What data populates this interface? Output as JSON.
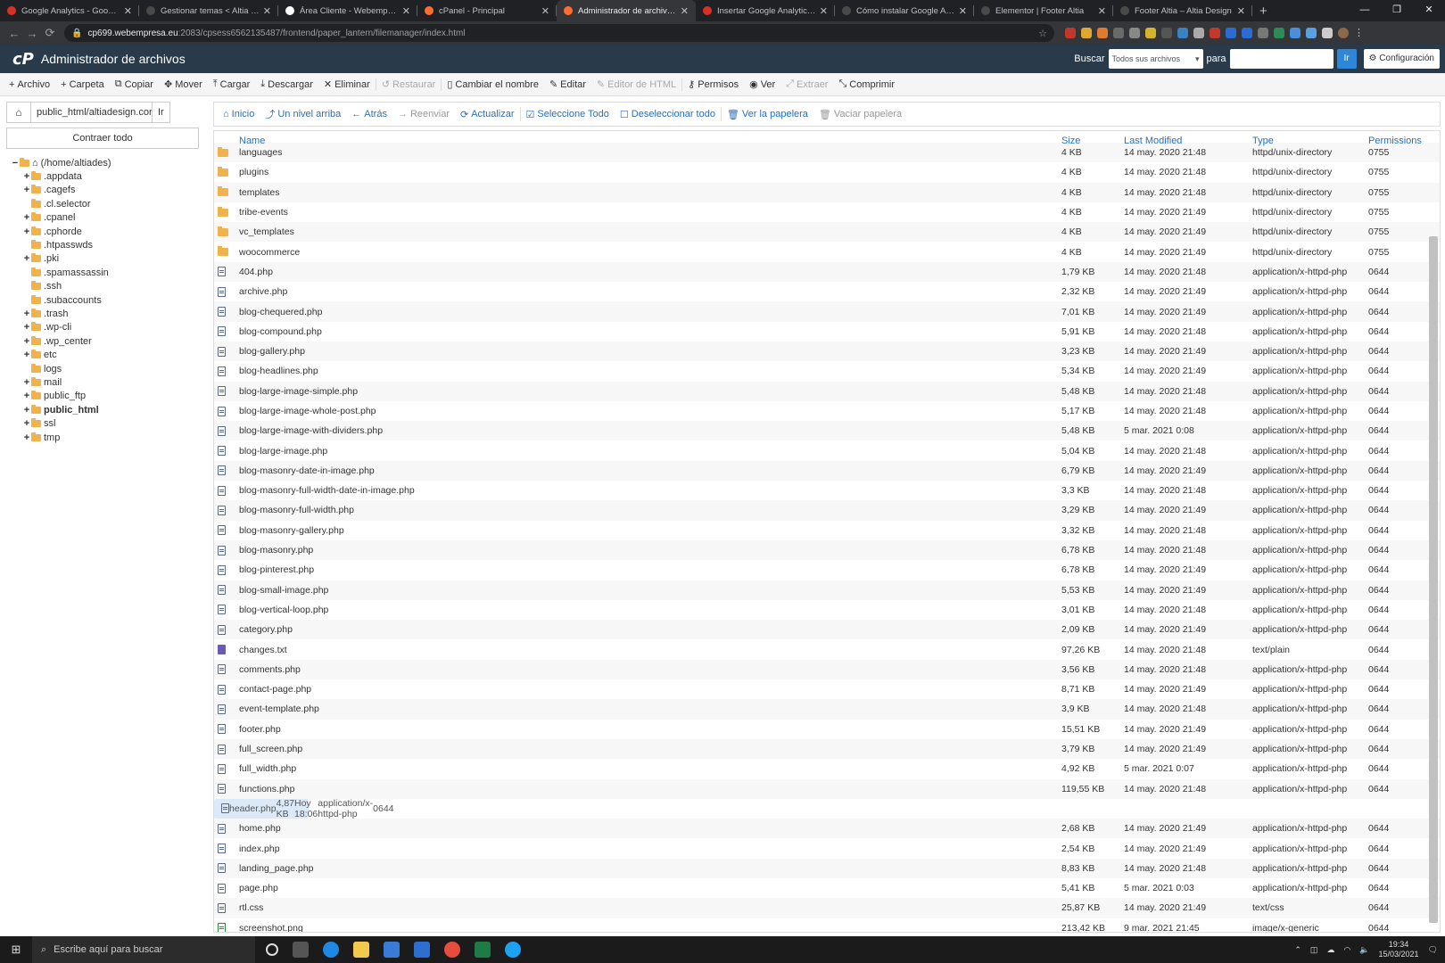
{
  "browser": {
    "tabs": [
      {
        "title": "Google Analytics - Google Tag",
        "color": "#d93025",
        "active": false
      },
      {
        "title": "Gestionar temas < Altia Design",
        "color": "#4a4a4a",
        "active": false
      },
      {
        "title": "Área Cliente - Webempresa E...",
        "color": "#ffffff",
        "active": false
      },
      {
        "title": "cPanel - Principal",
        "color": "#ff6c2c",
        "active": false
      },
      {
        "title": "Administrador de archivos cP...",
        "color": "#ff6c2c",
        "active": true
      },
      {
        "title": "Insertar Google Analytics con",
        "color": "#d93025",
        "active": false
      },
      {
        "title": "Cómo instalar Google Analytic",
        "color": "#4a4a4a",
        "active": false
      },
      {
        "title": "Elementor | Footer Altia",
        "color": "#4a4a4a",
        "active": false
      },
      {
        "title": "Footer Altia – Altia Design",
        "color": "#4a4a4a",
        "active": false
      }
    ],
    "url_host": "cp699.webempresa.eu",
    "url_rest": ":2083/cpsess6562135487/frontend/paper_lantern/filemanager/index.html"
  },
  "header": {
    "logo": "cP",
    "title": "Administrador de archivos",
    "search_label": "Buscar",
    "search_select": "Todos sus archivos",
    "for_label": "para",
    "go": "Ir",
    "settings": "Configuración"
  },
  "toolbar": {
    "items": [
      {
        "icon": "+",
        "label": "Archivo",
        "disabled": false
      },
      {
        "icon": "+",
        "label": "Carpeta",
        "disabled": false
      },
      {
        "icon": "⧉",
        "label": "Copiar",
        "disabled": false
      },
      {
        "icon": "✥",
        "label": "Mover",
        "disabled": false
      },
      {
        "icon": "⤒",
        "label": "Cargar",
        "disabled": false
      },
      {
        "icon": "⤓",
        "label": "Descargar",
        "disabled": false
      },
      {
        "icon": "✕",
        "label": "Eliminar",
        "disabled": false
      },
      {
        "icon": "↺",
        "label": "Restaurar",
        "disabled": true
      },
      {
        "icon": "▯",
        "label": "Cambiar el nombre",
        "disabled": false
      },
      {
        "icon": "✎",
        "label": "Editar",
        "disabled": false
      },
      {
        "icon": "✎",
        "label": "Editor de HTML",
        "disabled": true
      },
      {
        "icon": "⚷",
        "label": "Permisos",
        "disabled": false
      },
      {
        "icon": "◉",
        "label": "Ver",
        "disabled": false
      },
      {
        "icon": "⤢",
        "label": "Extraer",
        "disabled": true
      },
      {
        "icon": "⤡",
        "label": "Comprimir",
        "disabled": false
      }
    ]
  },
  "sidebar": {
    "path": "public_html/altiadesign.com/wp",
    "go": "Ir",
    "collapse_all": "Contraer todo",
    "tree": [
      {
        "label": "(/home/altiades)",
        "pm": "−",
        "indent": 0,
        "bold": false,
        "home": true
      },
      {
        "label": ".appdata",
        "pm": "+",
        "indent": 1,
        "bold": false
      },
      {
        "label": ".cagefs",
        "pm": "+",
        "indent": 1,
        "bold": false
      },
      {
        "label": ".cl.selector",
        "pm": "",
        "indent": 1,
        "bold": false
      },
      {
        "label": ".cpanel",
        "pm": "+",
        "indent": 1,
        "bold": false
      },
      {
        "label": ".cphorde",
        "pm": "+",
        "indent": 1,
        "bold": false
      },
      {
        "label": ".htpasswds",
        "pm": "",
        "indent": 1,
        "bold": false
      },
      {
        "label": ".pki",
        "pm": "+",
        "indent": 1,
        "bold": false
      },
      {
        "label": ".spamassassin",
        "pm": "",
        "indent": 1,
        "bold": false
      },
      {
        "label": ".ssh",
        "pm": "",
        "indent": 1,
        "bold": false
      },
      {
        "label": ".subaccounts",
        "pm": "",
        "indent": 1,
        "bold": false
      },
      {
        "label": ".trash",
        "pm": "+",
        "indent": 1,
        "bold": false
      },
      {
        "label": ".wp-cli",
        "pm": "+",
        "indent": 1,
        "bold": false
      },
      {
        "label": ".wp_center",
        "pm": "+",
        "indent": 1,
        "bold": false
      },
      {
        "label": "etc",
        "pm": "+",
        "indent": 1,
        "bold": false
      },
      {
        "label": "logs",
        "pm": "",
        "indent": 1,
        "bold": false
      },
      {
        "label": "mail",
        "pm": "+",
        "indent": 1,
        "bold": false
      },
      {
        "label": "public_ftp",
        "pm": "+",
        "indent": 1,
        "bold": false
      },
      {
        "label": "public_html",
        "pm": "+",
        "indent": 1,
        "bold": true
      },
      {
        "label": "ssl",
        "pm": "+",
        "indent": 1,
        "bold": false
      },
      {
        "label": "tmp",
        "pm": "+",
        "indent": 1,
        "bold": false
      }
    ]
  },
  "actions": {
    "items": [
      {
        "icon": "⌂",
        "label": "Inicio",
        "disabled": false
      },
      {
        "icon": "⤴",
        "label": "Un nivel arriba",
        "disabled": false
      },
      {
        "icon": "←",
        "label": "Atrás",
        "disabled": false
      },
      {
        "icon": "→",
        "label": "Reenviar",
        "disabled": true
      },
      {
        "icon": "⟳",
        "label": "Actualizar",
        "disabled": false
      },
      {
        "icon": "☑",
        "label": "Seleccione Todo",
        "disabled": false
      },
      {
        "icon": "☐",
        "label": "Deseleccionar todo",
        "disabled": false
      },
      {
        "icon": "🗑",
        "label": "Ver la papelera",
        "disabled": false
      },
      {
        "icon": "🗑",
        "label": "Vaciar papelera",
        "disabled": true
      }
    ]
  },
  "table": {
    "columns": [
      "Name",
      "Size",
      "Last Modified",
      "Type",
      "Permissions"
    ],
    "rows": [
      {
        "kind": "dir",
        "name": "languages",
        "size": "4 KB",
        "modified": "14 may. 2020 21:48",
        "type": "httpd/unix-directory",
        "perm": "0755"
      },
      {
        "kind": "dir",
        "name": "plugins",
        "size": "4 KB",
        "modified": "14 may. 2020 21:48",
        "type": "httpd/unix-directory",
        "perm": "0755"
      },
      {
        "kind": "dir",
        "name": "templates",
        "size": "4 KB",
        "modified": "14 may. 2020 21:48",
        "type": "httpd/unix-directory",
        "perm": "0755"
      },
      {
        "kind": "dir",
        "name": "tribe-events",
        "size": "4 KB",
        "modified": "14 may. 2020 21:49",
        "type": "httpd/unix-directory",
        "perm": "0755"
      },
      {
        "kind": "dir",
        "name": "vc_templates",
        "size": "4 KB",
        "modified": "14 may. 2020 21:49",
        "type": "httpd/unix-directory",
        "perm": "0755"
      },
      {
        "kind": "dir",
        "name": "woocommerce",
        "size": "4 KB",
        "modified": "14 may. 2020 21:49",
        "type": "httpd/unix-directory",
        "perm": "0755"
      },
      {
        "kind": "php",
        "name": "404.php",
        "size": "1,79 KB",
        "modified": "14 may. 2020 21:48",
        "type": "application/x-httpd-php",
        "perm": "0644"
      },
      {
        "kind": "php",
        "name": "archive.php",
        "size": "2,32 KB",
        "modified": "14 may. 2020 21:49",
        "type": "application/x-httpd-php",
        "perm": "0644"
      },
      {
        "kind": "php",
        "name": "blog-chequered.php",
        "size": "7,01 KB",
        "modified": "14 may. 2020 21:49",
        "type": "application/x-httpd-php",
        "perm": "0644"
      },
      {
        "kind": "php",
        "name": "blog-compound.php",
        "size": "5,91 KB",
        "modified": "14 may. 2020 21:48",
        "type": "application/x-httpd-php",
        "perm": "0644"
      },
      {
        "kind": "php",
        "name": "blog-gallery.php",
        "size": "3,23 KB",
        "modified": "14 may. 2020 21:49",
        "type": "application/x-httpd-php",
        "perm": "0644"
      },
      {
        "kind": "php",
        "name": "blog-headlines.php",
        "size": "5,34 KB",
        "modified": "14 may. 2020 21:49",
        "type": "application/x-httpd-php",
        "perm": "0644"
      },
      {
        "kind": "php",
        "name": "blog-large-image-simple.php",
        "size": "5,48 KB",
        "modified": "14 may. 2020 21:48",
        "type": "application/x-httpd-php",
        "perm": "0644"
      },
      {
        "kind": "php",
        "name": "blog-large-image-whole-post.php",
        "size": "5,17 KB",
        "modified": "14 may. 2020 21:48",
        "type": "application/x-httpd-php",
        "perm": "0644"
      },
      {
        "kind": "php",
        "name": "blog-large-image-with-dividers.php",
        "size": "5,48 KB",
        "modified": "5 mar. 2021 0:08",
        "type": "application/x-httpd-php",
        "perm": "0644"
      },
      {
        "kind": "php",
        "name": "blog-large-image.php",
        "size": "5,04 KB",
        "modified": "14 may. 2020 21:48",
        "type": "application/x-httpd-php",
        "perm": "0644"
      },
      {
        "kind": "php",
        "name": "blog-masonry-date-in-image.php",
        "size": "6,79 KB",
        "modified": "14 may. 2020 21:49",
        "type": "application/x-httpd-php",
        "perm": "0644"
      },
      {
        "kind": "php",
        "name": "blog-masonry-full-width-date-in-image.php",
        "size": "3,3 KB",
        "modified": "14 may. 2020 21:48",
        "type": "application/x-httpd-php",
        "perm": "0644"
      },
      {
        "kind": "php",
        "name": "blog-masonry-full-width.php",
        "size": "3,29 KB",
        "modified": "14 may. 2020 21:49",
        "type": "application/x-httpd-php",
        "perm": "0644"
      },
      {
        "kind": "php",
        "name": "blog-masonry-gallery.php",
        "size": "3,32 KB",
        "modified": "14 may. 2020 21:48",
        "type": "application/x-httpd-php",
        "perm": "0644"
      },
      {
        "kind": "php",
        "name": "blog-masonry.php",
        "size": "6,78 KB",
        "modified": "14 may. 2020 21:48",
        "type": "application/x-httpd-php",
        "perm": "0644"
      },
      {
        "kind": "php",
        "name": "blog-pinterest.php",
        "size": "6,78 KB",
        "modified": "14 may. 2020 21:49",
        "type": "application/x-httpd-php",
        "perm": "0644"
      },
      {
        "kind": "php",
        "name": "blog-small-image.php",
        "size": "5,53 KB",
        "modified": "14 may. 2020 21:49",
        "type": "application/x-httpd-php",
        "perm": "0644"
      },
      {
        "kind": "php",
        "name": "blog-vertical-loop.php",
        "size": "3,01 KB",
        "modified": "14 may. 2020 21:48",
        "type": "application/x-httpd-php",
        "perm": "0644"
      },
      {
        "kind": "php",
        "name": "category.php",
        "size": "2,09 KB",
        "modified": "14 may. 2020 21:49",
        "type": "application/x-httpd-php",
        "perm": "0644"
      },
      {
        "kind": "txt",
        "name": "changes.txt",
        "size": "97,26 KB",
        "modified": "14 may. 2020 21:48",
        "type": "text/plain",
        "perm": "0644"
      },
      {
        "kind": "php",
        "name": "comments.php",
        "size": "3,56 KB",
        "modified": "14 may. 2020 21:48",
        "type": "application/x-httpd-php",
        "perm": "0644"
      },
      {
        "kind": "php",
        "name": "contact-page.php",
        "size": "8,71 KB",
        "modified": "14 may. 2020 21:49",
        "type": "application/x-httpd-php",
        "perm": "0644"
      },
      {
        "kind": "php",
        "name": "event-template.php",
        "size": "3,9 KB",
        "modified": "14 may. 2020 21:48",
        "type": "application/x-httpd-php",
        "perm": "0644"
      },
      {
        "kind": "php",
        "name": "footer.php",
        "size": "15,51 KB",
        "modified": "14 may. 2020 21:49",
        "type": "application/x-httpd-php",
        "perm": "0644"
      },
      {
        "kind": "php",
        "name": "full_screen.php",
        "size": "3,79 KB",
        "modified": "14 may. 2020 21:49",
        "type": "application/x-httpd-php",
        "perm": "0644"
      },
      {
        "kind": "php",
        "name": "full_width.php",
        "size": "4,92 KB",
        "modified": "5 mar. 2021 0:07",
        "type": "application/x-httpd-php",
        "perm": "0644"
      },
      {
        "kind": "php",
        "name": "functions.php",
        "size": "119,55 KB",
        "modified": "14 may. 2020 21:48",
        "type": "application/x-httpd-php",
        "perm": "0644"
      },
      {
        "kind": "php",
        "name": "header.php",
        "size": "4,87 KB",
        "modified": "Hoy 18:06",
        "type": "application/x-httpd-php",
        "perm": "0644",
        "selected": true
      },
      {
        "kind": "php",
        "name": "home.php",
        "size": "2,68 KB",
        "modified": "14 may. 2020 21:49",
        "type": "application/x-httpd-php",
        "perm": "0644"
      },
      {
        "kind": "php",
        "name": "index.php",
        "size": "2,54 KB",
        "modified": "14 may. 2020 21:49",
        "type": "application/x-httpd-php",
        "perm": "0644"
      },
      {
        "kind": "php",
        "name": "landing_page.php",
        "size": "8,83 KB",
        "modified": "14 may. 2020 21:48",
        "type": "application/x-httpd-php",
        "perm": "0644"
      },
      {
        "kind": "php",
        "name": "page.php",
        "size": "5,41 KB",
        "modified": "5 mar. 2021 0:03",
        "type": "application/x-httpd-php",
        "perm": "0644"
      },
      {
        "kind": "php",
        "name": "rtl.css",
        "size": "25,87 KB",
        "modified": "14 may. 2020 21:49",
        "type": "text/css",
        "perm": "0644"
      },
      {
        "kind": "img",
        "name": "screenshot.png",
        "size": "213,42 KB",
        "modified": "9 mar. 2021 21:45",
        "type": "image/x-generic",
        "perm": "0644"
      }
    ]
  },
  "taskbar": {
    "search_placeholder": "Escribe aquí para buscar",
    "time": "19:34",
    "date": "15/03/2021"
  }
}
